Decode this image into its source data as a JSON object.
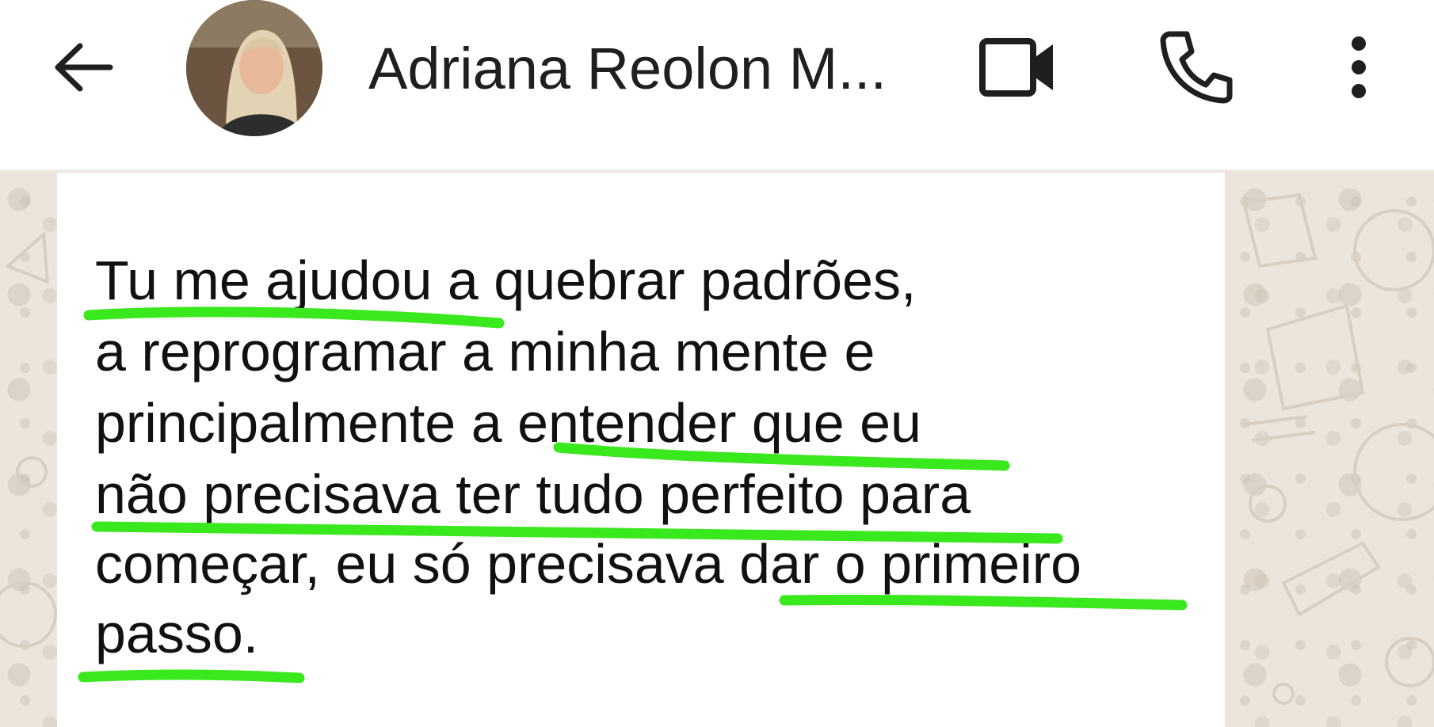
{
  "header": {
    "contact_name": "Adriana Reolon M...",
    "back_icon": "arrow-left-icon",
    "video_icon": "video-camera-icon",
    "call_icon": "phone-icon",
    "menu_icon": "more-vertical-icon"
  },
  "message": {
    "lines": [
      "Tu me ajudou a quebrar padrões,",
      "a reprogramar a minha mente e",
      "principalmente a entender que eu",
      "não precisava ter tudo perfeito para",
      "começar, eu só precisava dar o primeiro",
      "passo."
    ],
    "underlined_phrases": [
      "Tu me ajudou a",
      "entender que eu",
      "não precisava ter tudo perfeito para",
      "dar o primeiro",
      "passo."
    ],
    "highlight_color": "#39e81d"
  },
  "colors": {
    "header_bg": "#ffffff",
    "chat_bg": "#ece5dc",
    "bubble_bg": "#ffffff",
    "text": "#111111"
  }
}
